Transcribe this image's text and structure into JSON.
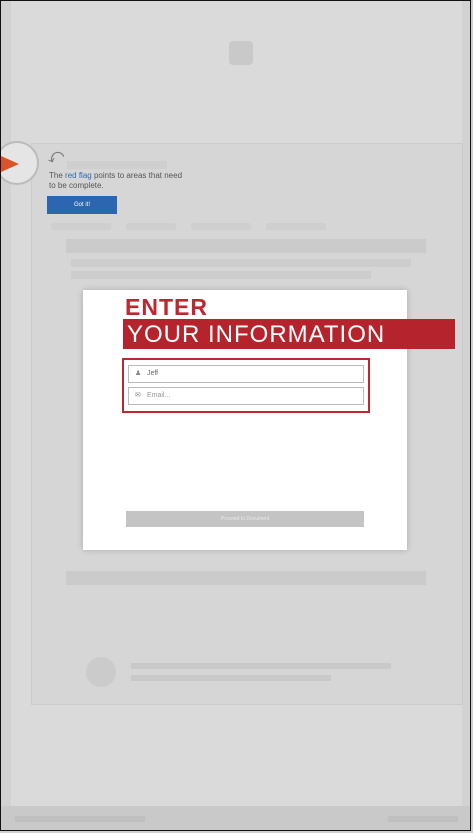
{
  "tour": {
    "text_prefix": "The",
    "flag_word": "red flag",
    "text_suffix": "points to areas that need to be complete.",
    "button_label": "Got it!"
  },
  "modal": {
    "heading_line1": "ENTER",
    "heading_line2": "YOUR INFORMATION",
    "name_field": {
      "value": "Jeff",
      "icon": "user-icon"
    },
    "email_field": {
      "placeholder": "Email...",
      "icon": "email-icon"
    },
    "proceed_label": "Proceed to Document"
  },
  "colors": {
    "brand_red": "#c0262f",
    "tour_blue": "#2c66b0",
    "flag_orange": "#d9542b"
  }
}
